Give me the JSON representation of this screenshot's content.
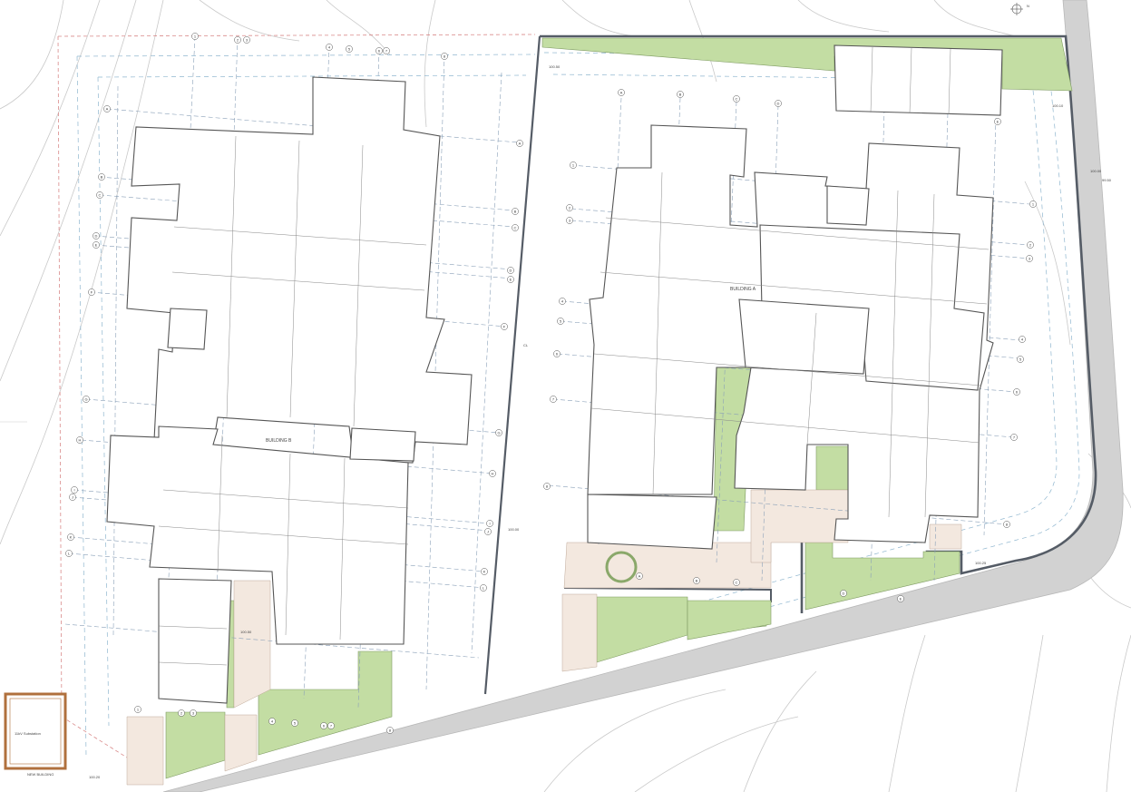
{
  "plan": {
    "building_a_label": "BUILDING A",
    "building_b_label": "BUILDING B",
    "boundary_label": "CL",
    "substation_text": "11kV Substation",
    "substation_note": "NEW BUILDING",
    "level_marks": [
      "100.50",
      "100.00",
      "100.25",
      "100.50",
      "100.10",
      "100.20",
      "99.50",
      "100.00"
    ],
    "grid_bubbles_b": [
      "A",
      "B",
      "C",
      "D",
      "E",
      "F",
      "G",
      "H",
      "I",
      "J",
      "K",
      "L"
    ],
    "grid_bubbles_a": [
      "A",
      "B",
      "C",
      "D",
      "E",
      "1",
      "2",
      "3",
      "4",
      "5",
      "6",
      "7",
      "8"
    ],
    "north": "N"
  }
}
